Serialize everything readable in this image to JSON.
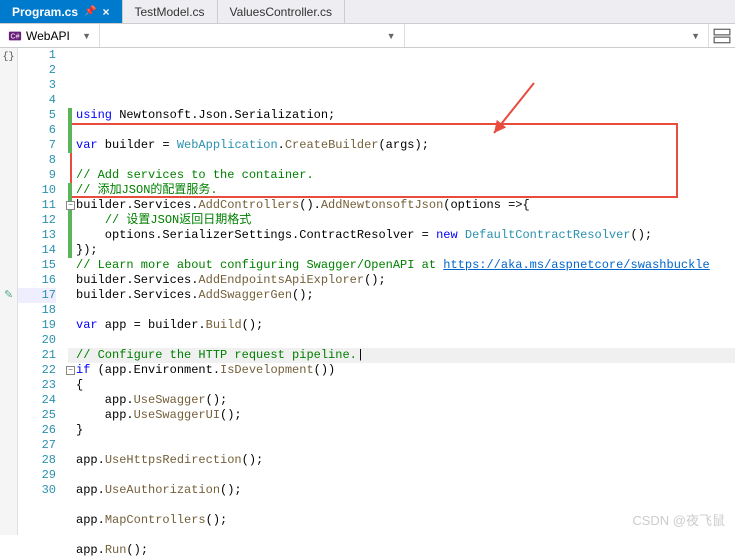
{
  "tabs": [
    {
      "label": "Program.cs",
      "active": true
    },
    {
      "label": "TestModel.cs",
      "active": false
    },
    {
      "label": "ValuesController.cs",
      "active": false
    }
  ],
  "nav": {
    "project": "WebAPI"
  },
  "watermark": "CSDN @夜飞鼠",
  "lines": [
    {
      "n": 1,
      "bar": true,
      "html": "<span class='kw'>using</span> Newtonsoft.Json.Serialization;"
    },
    {
      "n": 2,
      "bar": true,
      "html": ""
    },
    {
      "n": 3,
      "bar": true,
      "html": "<span class='kw'>var</span> builder = <span class='type'>WebApplication</span>.<span class='method'>CreateBuilder</span>(args);"
    },
    {
      "n": 4,
      "bar": false,
      "html": ""
    },
    {
      "n": 5,
      "bar": false,
      "html": "<span class='cmt'>// Add services to the container.</span>"
    },
    {
      "n": 6,
      "bar": true,
      "html": "<span class='cmt'>// 添加JSON的配置服务.</span>"
    },
    {
      "n": 7,
      "bar": true,
      "collapse": true,
      "html": "builder.Services.<span class='method'>AddControllers</span>().<span class='method'>AddNewtonsoftJson</span>(options =&gt;{"
    },
    {
      "n": 8,
      "bar": true,
      "html": "    <span class='cmt'>// 设置JSON返回日期格式</span>"
    },
    {
      "n": 9,
      "bar": true,
      "html": "    options.SerializerSettings.ContractResolver = <span class='kw'>new</span> <span class='type'>DefaultContractResolver</span>();"
    },
    {
      "n": 10,
      "bar": true,
      "html": "});"
    },
    {
      "n": 11,
      "bar": false,
      "html": "<span class='cmt'>// Learn more about configuring Swagger/OpenAPI at <span class='link'>https://aka.ms/aspnetcore/swashbuckle</span></span>"
    },
    {
      "n": 12,
      "bar": false,
      "html": "builder.Services.<span class='method'>AddEndpointsApiExplorer</span>();"
    },
    {
      "n": 13,
      "bar": false,
      "html": "builder.Services.<span class='method'>AddSwaggerGen</span>();"
    },
    {
      "n": 14,
      "bar": false,
      "html": ""
    },
    {
      "n": 15,
      "bar": false,
      "html": "<span class='kw'>var</span> app = builder.<span class='method'>Build</span>();"
    },
    {
      "n": 16,
      "bar": false,
      "html": ""
    },
    {
      "n": 17,
      "bar": false,
      "caret": true,
      "edit": true,
      "html": "<span class='cmt'>// Configure the HTTP request pipeline.</span>|"
    },
    {
      "n": 18,
      "bar": false,
      "collapse": true,
      "html": "<span class='kw'>if</span> (app.Environment.<span class='method'>IsDevelopment</span>())"
    },
    {
      "n": 19,
      "bar": false,
      "html": "{"
    },
    {
      "n": 20,
      "bar": false,
      "html": "    app.<span class='method'>UseSwagger</span>();"
    },
    {
      "n": 21,
      "bar": false,
      "html": "    app.<span class='method'>UseSwaggerUI</span>();"
    },
    {
      "n": 22,
      "bar": false,
      "html": "}"
    },
    {
      "n": 23,
      "bar": false,
      "html": ""
    },
    {
      "n": 24,
      "bar": false,
      "html": "app.<span class='method'>UseHttpsRedirection</span>();"
    },
    {
      "n": 25,
      "bar": false,
      "html": ""
    },
    {
      "n": 26,
      "bar": false,
      "html": "app.<span class='method'>UseAuthorization</span>();"
    },
    {
      "n": 27,
      "bar": false,
      "html": ""
    },
    {
      "n": 28,
      "bar": false,
      "html": "app.<span class='method'>MapControllers</span>();"
    },
    {
      "n": 29,
      "bar": false,
      "html": ""
    },
    {
      "n": 30,
      "bar": false,
      "html": "app.<span class='method'>Run</span>();"
    }
  ]
}
